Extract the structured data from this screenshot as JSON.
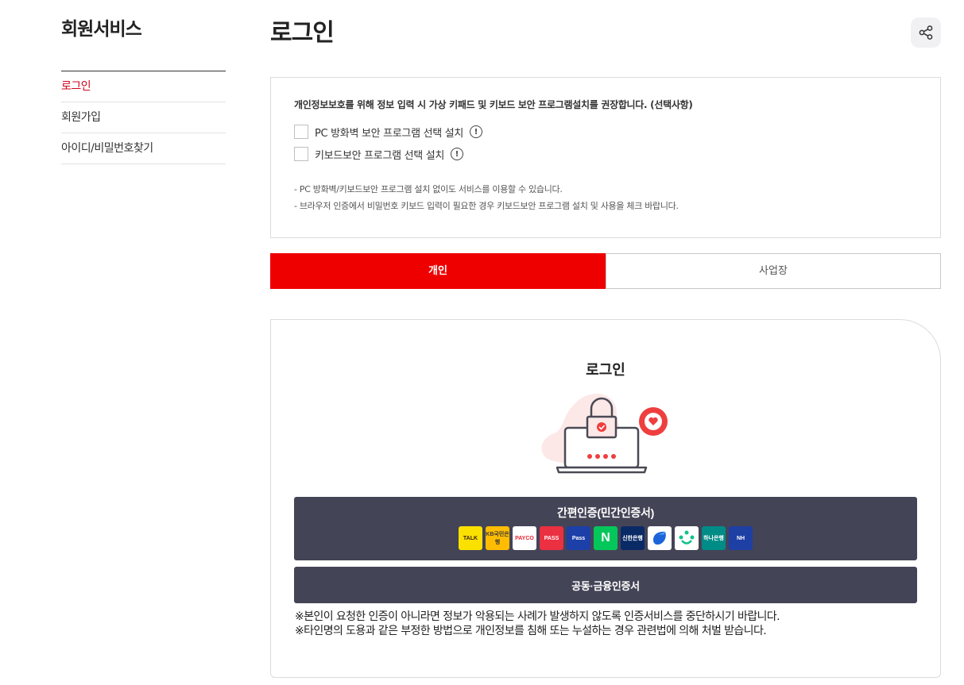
{
  "sidebar": {
    "title": "회원서비스",
    "items": [
      {
        "label": "로그인",
        "active": true
      },
      {
        "label": "회원가입",
        "active": false
      },
      {
        "label": "아이디/비밀번호찾기",
        "active": false
      }
    ]
  },
  "header": {
    "title": "로그인",
    "share_icon": "share-icon"
  },
  "notice": {
    "heading": "개인정보보호를 위해 정보 입력 시 가상 키패드 및 키보드 보안 프로그램설치를 권장합니다. (선택사항)",
    "options": [
      {
        "label": "PC 방화벽 보안 프로그램 선택 설치",
        "checked": false
      },
      {
        "label": "키보드보안 프로그램 선택 설치",
        "checked": false
      }
    ],
    "notes": [
      "-  PC 방화벽/키보드보안 프로그램 설치 없이도 서비스를 이용할 수 있습니다.",
      "-  브라우저 인증에서 비밀번호 키보드 입력이 필요한 경우 키보드보안 프로그램 설치 및 사용을 체크 바랍니다."
    ]
  },
  "tabs": [
    {
      "label": "개인",
      "active": true
    },
    {
      "label": "사업장",
      "active": false
    }
  ],
  "login": {
    "title": "로그인",
    "easy_auth_label": "간편인증(민간인증서)",
    "cert_providers": [
      {
        "name": "kakao",
        "text": "TALK",
        "bg": "#fae100",
        "fg": "#3a1d1d"
      },
      {
        "name": "kb",
        "text": "KB국민은행",
        "bg": "#ffbc00",
        "fg": "#3a3a3a"
      },
      {
        "name": "payco",
        "text": "PAYCO",
        "bg": "#ffffff",
        "fg": "#e8262d"
      },
      {
        "name": "pass",
        "text": "PASS",
        "bg": "#ea3041",
        "fg": "#ffffff"
      },
      {
        "name": "samsung-pass",
        "text": "Pass",
        "bg": "#1c3fa8",
        "fg": "#ffffff"
      },
      {
        "name": "naver",
        "text": "N",
        "bg": "#03c75a",
        "fg": "#ffffff"
      },
      {
        "name": "shinhan",
        "text": "신한은행",
        "bg": "#0a2a66",
        "fg": "#ffffff"
      },
      {
        "name": "toss",
        "text": "",
        "bg": "#ffffff",
        "fg": "#1b64da"
      },
      {
        "name": "bank-salad",
        "text": "",
        "bg": "#ffffff",
        "fg": "#12c28b"
      },
      {
        "name": "hana",
        "text": "하나은행",
        "bg": "#008c86",
        "fg": "#ffffff"
      },
      {
        "name": "nh",
        "text": "NH",
        "bg": "#1e3fa4",
        "fg": "#ffffff"
      }
    ],
    "joint_cert_label": "공동·금융인증서",
    "warnings": [
      "※본인이 요청한 인증이 아니라면 정보가 악용되는 사례가 발생하지 않도록 인증서비스를 중단하시기 바랍니다.",
      "※타인명의 도용과 같은 부정한 방법으로 개인정보를 침해 또는 누설하는 경우 관련법에 의해 처벌 받습니다."
    ]
  },
  "colors": {
    "accent_red": "#ee0000",
    "active_nav_red": "#d2051e",
    "button_dark": "#444457"
  }
}
